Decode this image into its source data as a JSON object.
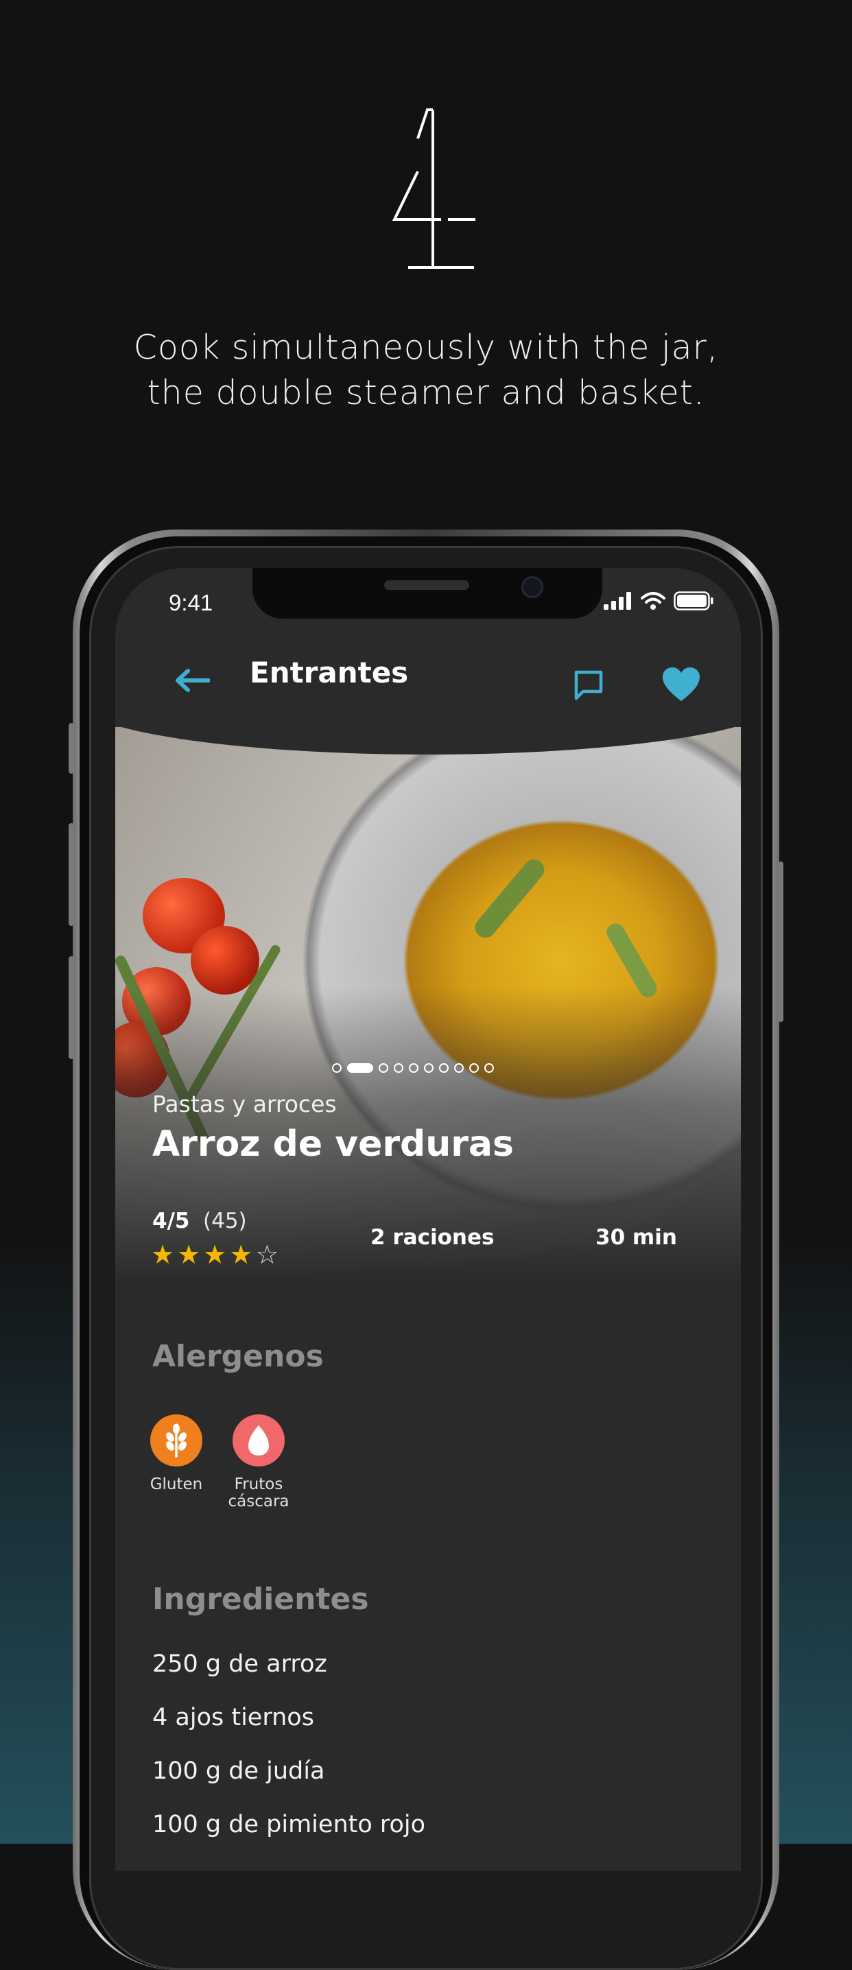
{
  "promo": {
    "step_number": "4",
    "tagline_line1": "Cook simultaneously with the jar,",
    "tagline_line2": "the double steamer and basket."
  },
  "status_bar": {
    "time": "9:41"
  },
  "nav": {
    "title": "Entrantes",
    "accent_color": "#3fb0cf"
  },
  "carousel": {
    "total_slides": 10,
    "active_index": 1
  },
  "recipe": {
    "category": "Pastas y arroces",
    "title": "Arroz de verduras",
    "rating": "4/5",
    "rating_count": "(45)",
    "rating_stars": 4,
    "rating_max": 5,
    "servings": "2 raciones",
    "time": "30 min"
  },
  "allergens": {
    "heading": "Alergenos",
    "items": [
      {
        "label": "Gluten",
        "icon": "wheat-icon",
        "color": "#f07f1e"
      },
      {
        "label": "Frutos cáscara",
        "icon": "nut-icon",
        "color": "#f0686a"
      }
    ]
  },
  "ingredients": {
    "heading": "Ingredientes",
    "items": [
      "250 g de arroz",
      "4 ajos tiernos",
      "100 g de judía",
      "100 g de pimiento rojo"
    ]
  }
}
